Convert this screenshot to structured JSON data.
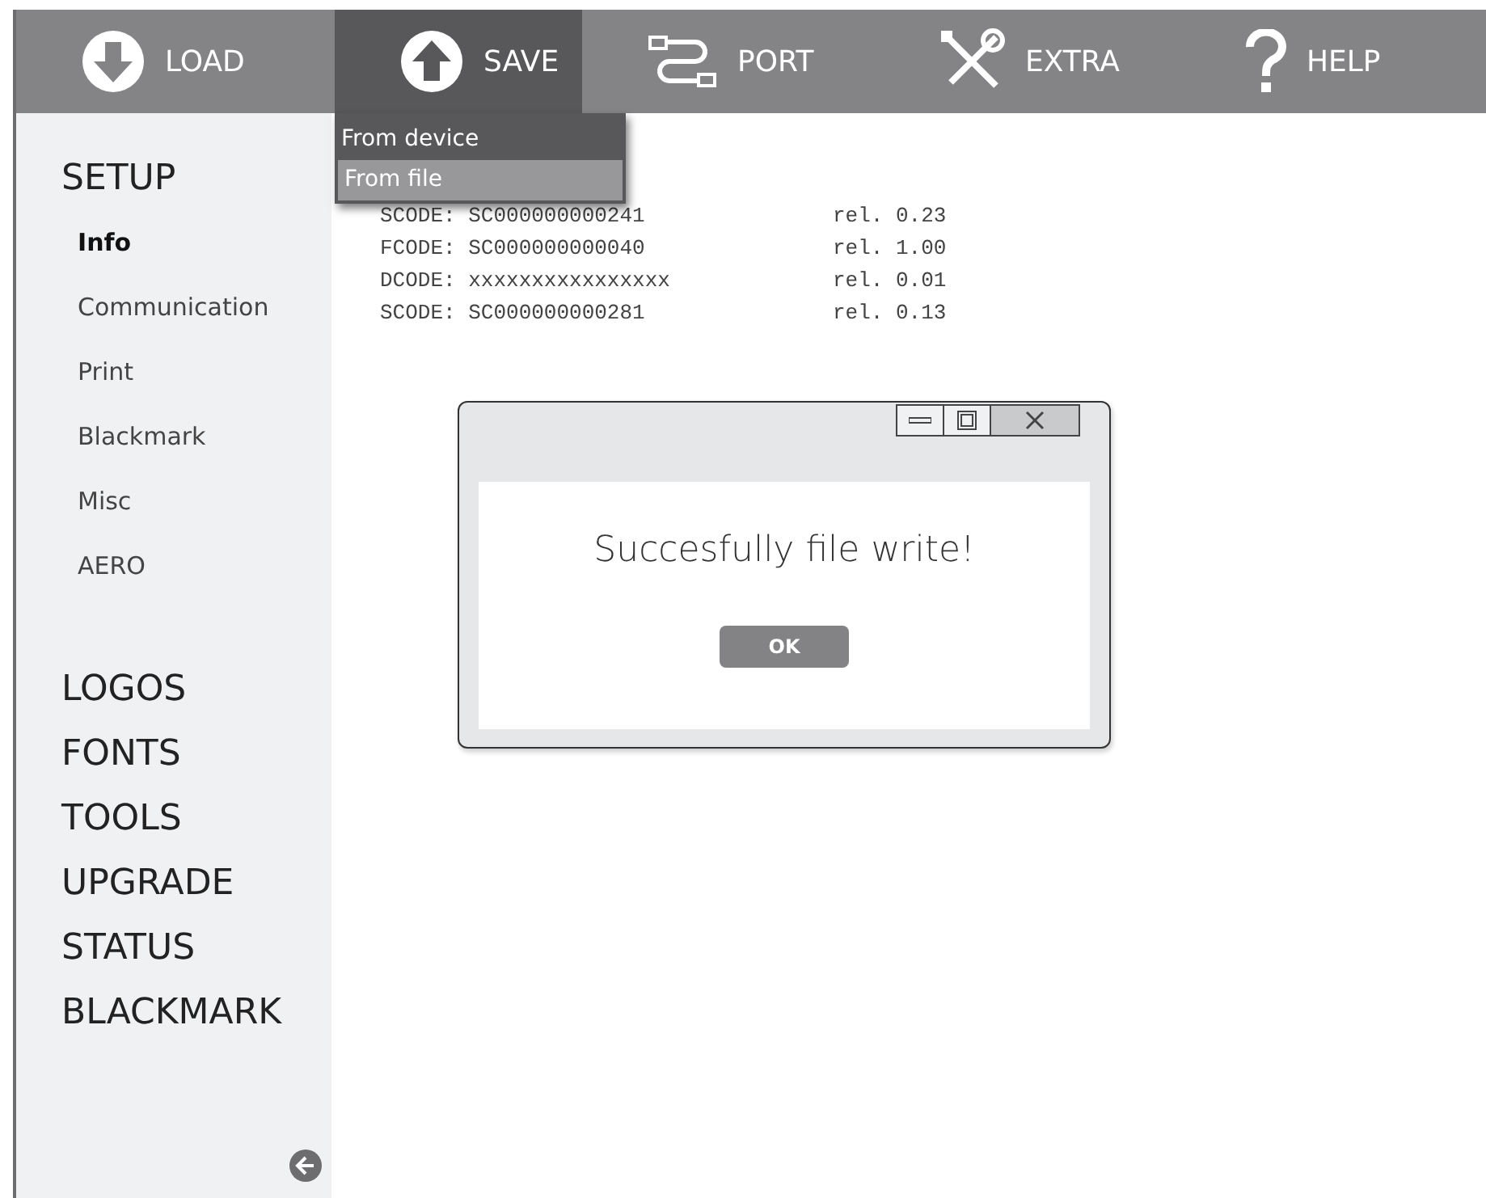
{
  "toolbar": [
    {
      "label": "LOAD",
      "kind": "load",
      "selected": false
    },
    {
      "label": "SAVE",
      "kind": "save",
      "selected": true,
      "menu": [
        {
          "label": "From device",
          "selected": false
        },
        {
          "label": "From file",
          "selected": true
        }
      ]
    },
    {
      "label": "PORT",
      "kind": "port",
      "selected": false
    },
    {
      "label": "EXTRA",
      "kind": "extra",
      "selected": false
    },
    {
      "label": "HELP",
      "kind": "help",
      "selected": false
    }
  ],
  "sidebar": {
    "sections": [
      {
        "label": "SETUP",
        "children": [
          {
            "label": "Info",
            "selected": true
          },
          {
            "label": "Communication",
            "selected": false
          },
          {
            "label": "Print",
            "selected": false
          },
          {
            "label": "Blackmark",
            "selected": false
          },
          {
            "label": "Misc",
            "selected": false
          },
          {
            "label": "AERO",
            "selected": false
          }
        ]
      },
      {
        "label": "LOGOS"
      },
      {
        "label": "FONTS"
      },
      {
        "label": "TOOLS"
      },
      {
        "label": "UPGRADE"
      },
      {
        "label": "STATUS"
      },
      {
        "label": "BLACKMARK"
      }
    ]
  },
  "info_lines": [
    {
      "code": "SCODE: SC000000000241",
      "rel": "rel. 0.23"
    },
    {
      "code": "FCODE: SC000000000040",
      "rel": "rel. 1.00"
    },
    {
      "code": "DCODE: xxxxxxxxxxxxxxxx",
      "rel": "rel. 0.01"
    },
    {
      "code": "SCODE: SC000000000281",
      "rel": "rel. 0.13"
    }
  ],
  "dialog": {
    "message": "Succesfully file write!",
    "button": "OK"
  }
}
